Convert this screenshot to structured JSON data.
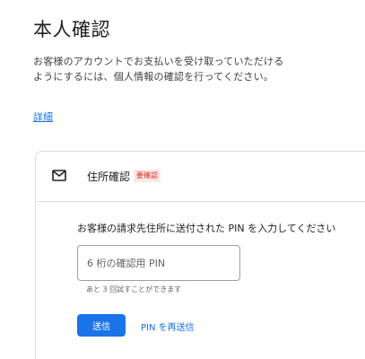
{
  "header": {
    "title": "本人確認",
    "description": "お客様のアカウントでお支払いを受け取っていただけるようにするには、個人情報の確認を行ってください。",
    "details_link": "詳細"
  },
  "card": {
    "icon": "mail-icon",
    "title": "住所確認",
    "badge": "要確認",
    "instruction": "お客様の請求先住所に送付された PIN を入力してください",
    "pin_input": {
      "placeholder": "6 桁の確認用 PIN",
      "value": ""
    },
    "attempts_text": "あと 3 回試すことができます",
    "submit_label": "送信",
    "resend_label": "PIN を再送信"
  },
  "colors": {
    "accent": "#1a73e8",
    "badge_text": "#d93025",
    "badge_bg": "#fce8e6",
    "border": "#dadce0"
  }
}
